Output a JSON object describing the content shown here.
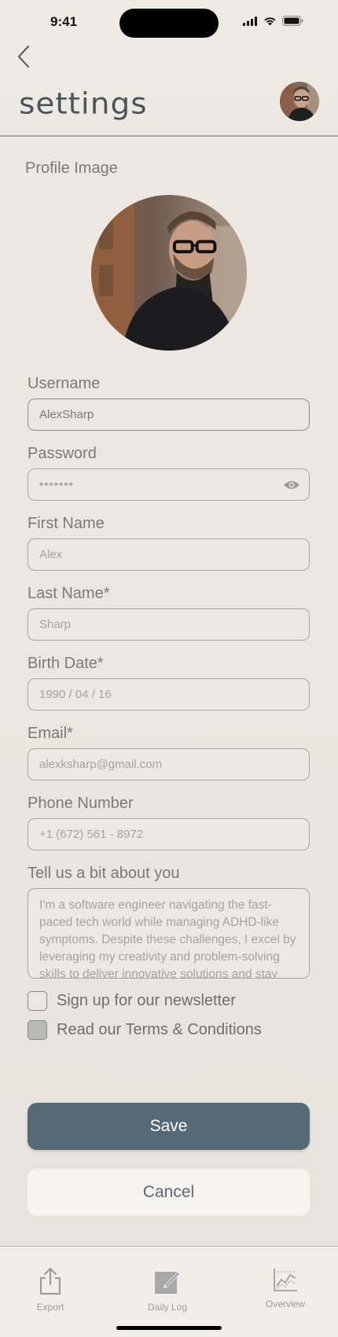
{
  "status_bar": {
    "time": "9:41"
  },
  "header": {
    "title": "settings"
  },
  "profile": {
    "section_label": "Profile Image"
  },
  "form": {
    "username": {
      "label": "Username",
      "value": "AlexSharp"
    },
    "password": {
      "label": "Password",
      "value": "•••••••"
    },
    "first_name": {
      "label": "First Name",
      "placeholder": "Alex"
    },
    "last_name": {
      "label": "Last Name*",
      "placeholder": "Sharp"
    },
    "birth_date": {
      "label": "Birth Date*",
      "placeholder": "1990 / 04 / 16"
    },
    "email": {
      "label": "Email*",
      "placeholder": "alexksharp@gmail.com"
    },
    "phone": {
      "label": "Phone Number",
      "placeholder": "+1 (672) 561 - 8972"
    },
    "about": {
      "label": "Tell us a bit about you",
      "placeholder": "I'm a software engineer navigating the fast-paced tech world while managing ADHD-like symptoms. Despite these challenges, I excel by leveraging my creativity and problem-solving skills to deliver innovative solutions and stay"
    },
    "newsletter": {
      "label": "Sign up for our newsletter",
      "checked": false
    },
    "terms": {
      "label": "Read our Terms & Conditions",
      "checked": true
    }
  },
  "actions": {
    "save": "Save",
    "cancel": "Cancel"
  },
  "tabs": [
    {
      "label": "Export",
      "icon": "share-icon"
    },
    {
      "label": "Daily Log",
      "icon": "edit-icon"
    },
    {
      "label": "Overview",
      "icon": "chart-icon"
    }
  ],
  "colors": {
    "primary_button": "#566a75",
    "title": "#4a5559",
    "background": "#ece7e0"
  }
}
